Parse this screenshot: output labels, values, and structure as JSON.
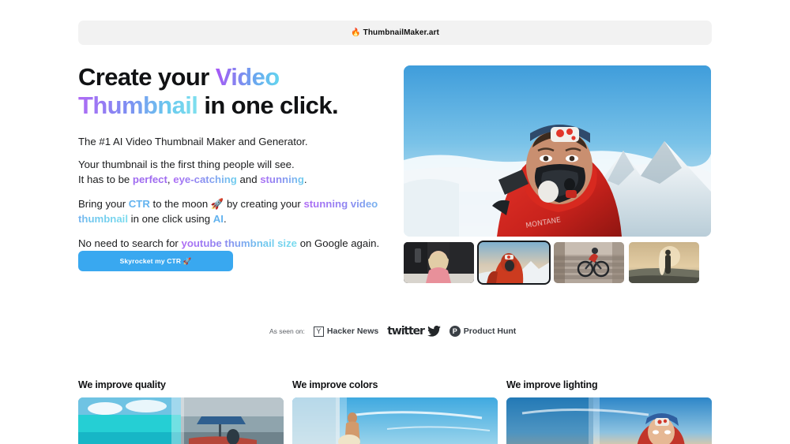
{
  "topbar": {
    "brand": "ThumbnailMaker.art",
    "flame_icon": "🔥"
  },
  "hero": {
    "headline": {
      "part1": "Create your ",
      "accent1": "Video",
      "accent2": "Thumbnail",
      "part2": " in one click."
    },
    "lede": "The #1 AI Video Thumbnail Maker and Generator.",
    "para1": {
      "line1": "Your thumbnail is the first thing people will see.",
      "line2_a": "It has to be ",
      "kw1": "perfect",
      "line2_b": ", ",
      "kw2": "eye-catching",
      "line2_c": " and ",
      "kw3": "stunning",
      "line2_d": "."
    },
    "para2": {
      "a": "Bring your ",
      "kw1": "CTR",
      "b": " to the moon ",
      "rocket": "🚀",
      "c": " by creating your ",
      "kw2": "stunning video thumbnail",
      "d": " in one click using ",
      "kw3": "AI",
      "e": "."
    },
    "para3": {
      "a": "No need to search for ",
      "kw1": "youtube thumbnail size",
      "b": " on Google again."
    },
    "cta_label": "Skyrocket my CTR 🚀",
    "main_image_alt": "mountaineer-in-red-jacket-with-oxygen-mask-on-snowy-summit"
  },
  "thumbnails": [
    {
      "alt": "woman-in-pink-sweater-at-desk",
      "selected": false
    },
    {
      "alt": "climber-in-red-suit-above-clouds",
      "selected": true
    },
    {
      "alt": "cyclist-riding-down-stone-stairs",
      "selected": false
    },
    {
      "alt": "surfer-silhouette-holding-board-at-sunset",
      "selected": false
    }
  ],
  "social_proof": {
    "label": "As seen on:",
    "items": [
      {
        "name": "Hacker News",
        "icon": "Y"
      },
      {
        "name": "twitter",
        "icon": "bird-icon"
      },
      {
        "name": "Product Hunt",
        "icon": "P"
      }
    ]
  },
  "features": [
    {
      "title": "We improve quality",
      "image_alt": "tropical-beach-boat-before-after"
    },
    {
      "title": "We improve colors",
      "image_alt": "surfer-on-beach-before-after"
    },
    {
      "title": "We improve lighting",
      "image_alt": "woman-in-red-hood-before-after"
    }
  ],
  "colors": {
    "accent_blue": "#39a8f0",
    "gradient_start": "#a855f7",
    "gradient_end": "#63d8ef",
    "topbar_bg": "#f2f2f2",
    "text": "#111214"
  }
}
